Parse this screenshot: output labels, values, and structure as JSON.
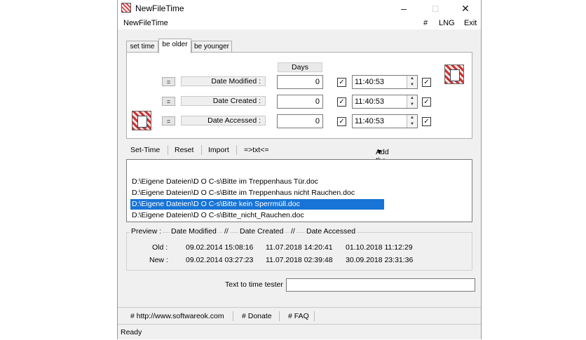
{
  "window": {
    "title": "NewFileTime"
  },
  "menu": {
    "app_name": "NewFileTime",
    "hash": "#",
    "lng": "LNG",
    "exit": "Exit"
  },
  "tabs": [
    {
      "label": "set time",
      "active": false
    },
    {
      "label": "be older",
      "active": true
    },
    {
      "label": "be younger",
      "active": false
    }
  ],
  "panel": {
    "days_header": "Days",
    "equal_label": "=",
    "rows": [
      {
        "label": "Date Modified :",
        "days": "0",
        "time": "11:40:53",
        "days_checked": true,
        "time_checked": true
      },
      {
        "label": "Date Created :",
        "days": "0",
        "time": "11:40:53",
        "days_checked": true,
        "time_checked": true
      },
      {
        "label": "Date Accessed :",
        "days": "0",
        "time": "11:40:53",
        "days_checked": true,
        "time_checked": true
      }
    ]
  },
  "toolbar": {
    "set_time": "Set-Time",
    "reset": "Reset",
    "import": "Import",
    "txt": "=>txt<=",
    "drag_drop": "Add the files via drag & drop"
  },
  "files": [
    {
      "path": "D:\\Eigene Dateien\\D O C-s\\Bitte im Treppenhaus Tür.doc",
      "selected": false
    },
    {
      "path": "D:\\Eigene Dateien\\D O C-s\\Bitte im Treppenhaus nicht Rauchen.doc",
      "selected": false
    },
    {
      "path": "D:\\Eigene Dateien\\D O C-s\\Bitte kein Sperrmüll.doc",
      "selected": true
    },
    {
      "path": "D:\\Eigene Dateien\\D O C-s\\Bitte_nicht_Rauchen.doc",
      "selected": false
    }
  ],
  "preview": {
    "label": "Preview :",
    "h_modified": "Date Modified",
    "sep": "//",
    "h_created": "Date Created",
    "h_accessed": "Date Accessed",
    "old_label": "Old :",
    "new_label": "New :",
    "old": {
      "modified": "09.02.2014 15:08:16",
      "created": "11.07.2018 14:20:41",
      "accessed": "01.10.2018 11:12:29"
    },
    "new": {
      "modified": "09.02.2014 03:27:23",
      "created": "11.07.2018 02:39:48",
      "accessed": "30.09.2018 23:31:36"
    }
  },
  "tester": {
    "label": "Text to time tester",
    "value": ""
  },
  "links": {
    "website": "# http://www.softwareok.com",
    "donate": "# Donate",
    "faq": "# FAQ"
  },
  "status": {
    "text": "Ready"
  },
  "colors": {
    "selection": "#1874d6",
    "window_bg": "#f0f0f0"
  }
}
